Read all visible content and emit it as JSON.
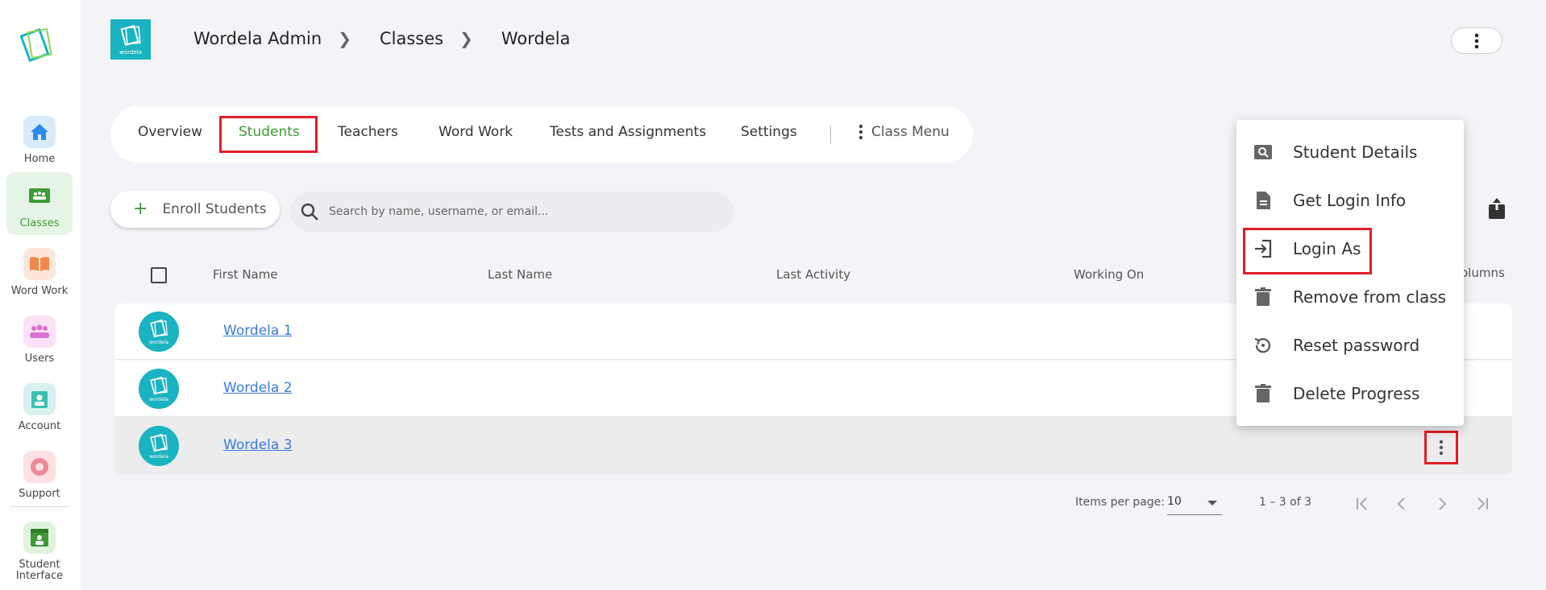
{
  "sidebar": {
    "items": [
      {
        "label": "Home",
        "icon": "home-icon"
      },
      {
        "label": "Classes",
        "icon": "classes-icon"
      },
      {
        "label": "Word Work",
        "icon": "book-icon"
      },
      {
        "label": "Users",
        "icon": "users-icon"
      },
      {
        "label": "Account",
        "icon": "account-icon"
      },
      {
        "label": "Support",
        "icon": "support-icon"
      },
      {
        "label": "Student Interface",
        "icon": "student-interface-icon"
      }
    ],
    "active": "Classes",
    "active_color": "#3e9a36"
  },
  "header": {
    "brand_text": "wordela",
    "breadcrumbs": [
      "Wordela Admin",
      "Classes",
      "Wordela"
    ]
  },
  "tabs": {
    "items": [
      "Overview",
      "Students",
      "Teachers",
      "Word Work",
      "Tests and Assignments",
      "Settings"
    ],
    "active": "Students",
    "class_menu": "Class Menu"
  },
  "controls": {
    "enroll_label": "Enroll Students",
    "search_placeholder": "Search by name, username, or email..."
  },
  "table": {
    "columns": [
      "First Name",
      "Last Name",
      "Last Activity",
      "Working On"
    ],
    "columns_menu_partial": "olumns",
    "rows": [
      {
        "first_name": "Wordela 1",
        "avatar_text": "wordela"
      },
      {
        "first_name": "Wordela 2",
        "avatar_text": "wordela"
      },
      {
        "first_name": "Wordela 3",
        "avatar_text": "wordela"
      }
    ]
  },
  "paginator": {
    "items_per_page_label": "Items per page:",
    "items_per_page": "10",
    "range": "1 – 3 of 3"
  },
  "menu": {
    "items": [
      {
        "label": "Student Details",
        "icon": "search-doc-icon"
      },
      {
        "label": "Get Login Info",
        "icon": "document-icon"
      },
      {
        "label": "Login As",
        "icon": "login-icon"
      },
      {
        "label": "Remove from class",
        "icon": "trash-icon"
      },
      {
        "label": "Reset password",
        "icon": "reset-icon"
      },
      {
        "label": "Delete Progress",
        "icon": "trash-icon"
      }
    ],
    "highlighted": "Login As"
  },
  "colors": {
    "accent_green": "#3e9a36",
    "brand_teal": "#1ab3c1",
    "link_blue": "#3b7be0",
    "highlight_red": "#e01e28"
  }
}
